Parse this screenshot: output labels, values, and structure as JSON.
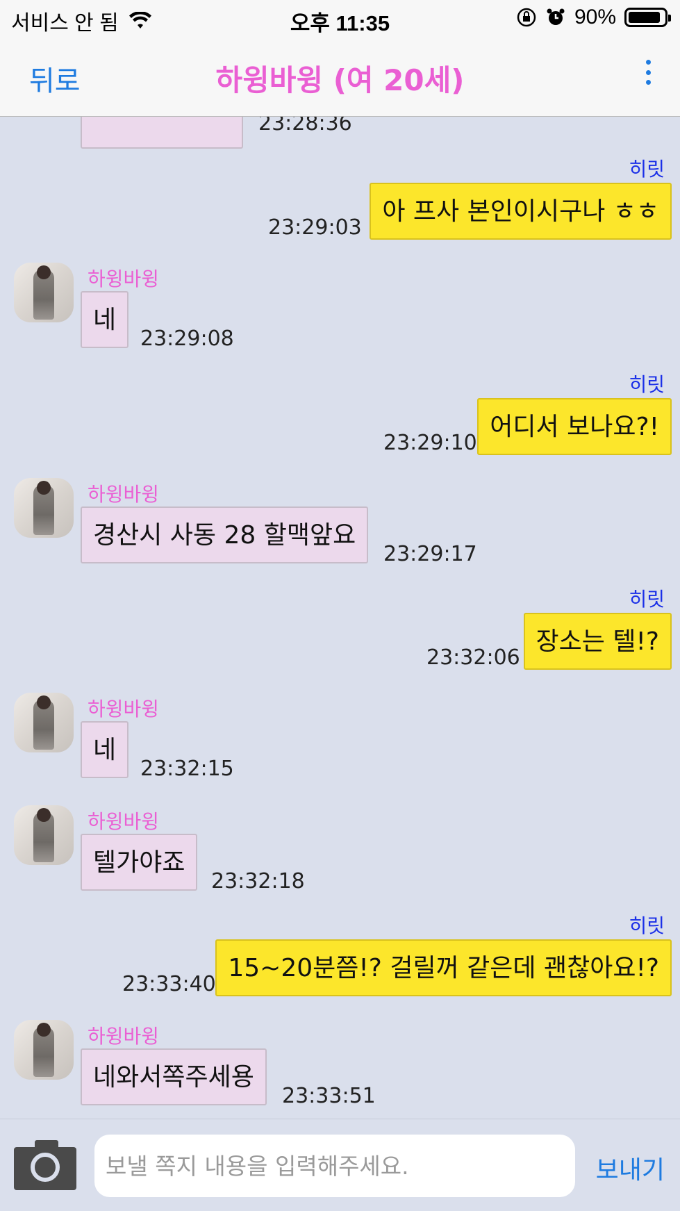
{
  "status_bar": {
    "carrier": "서비스 안 됨",
    "time": "오후 11:35",
    "battery": "90%",
    "battery_level": 0.9
  },
  "nav": {
    "back": "뒤로",
    "title": "하윙바윙 (여 20세)"
  },
  "chat": {
    "partial_top_time": "23:28:36",
    "messages": [
      {
        "dir": "out",
        "sender": "히릿",
        "text": "아 프사 본인이시구나 ㅎㅎ",
        "time": "23:29:03"
      },
      {
        "dir": "in",
        "sender": "하윙바윙",
        "text": "네",
        "time": "23:29:08"
      },
      {
        "dir": "out",
        "sender": "히릿",
        "text": "어디서 보나요?!",
        "time": "23:29:10"
      },
      {
        "dir": "in",
        "sender": "하윙바윙",
        "text": "경산시 사동 28 할맥앞요",
        "time": "23:29:17"
      },
      {
        "dir": "out",
        "sender": "히릿",
        "text": "장소는 텔!?",
        "time": "23:32:06"
      },
      {
        "dir": "in",
        "sender": "하윙바윙",
        "text": "네",
        "time": "23:32:15"
      },
      {
        "dir": "in",
        "sender": "하윙바윙",
        "text": "텔가야죠",
        "time": "23:32:18"
      },
      {
        "dir": "out",
        "sender": "히릿",
        "text": "15~20분쯤!? 걸릴꺼 같은데 괜찮아요!?",
        "time": "23:33:40"
      },
      {
        "dir": "in",
        "sender": "하윙바윙",
        "text": "네와서쪽주세용",
        "time": "23:33:51"
      }
    ]
  },
  "input": {
    "placeholder": "보낼 쪽지 내용을 입력해주세요.",
    "send": "보내기"
  }
}
